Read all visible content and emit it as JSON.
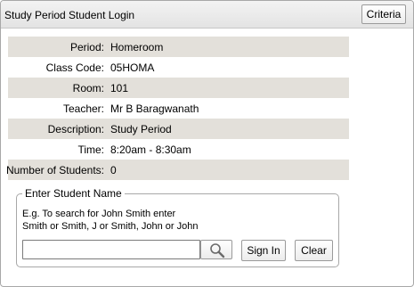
{
  "header": {
    "title": "Study Period Student Login",
    "criteria_label": "Criteria"
  },
  "details": [
    {
      "label": "Period:",
      "value": "Homeroom"
    },
    {
      "label": "Class Code:",
      "value": "05HOMA"
    },
    {
      "label": "Room:",
      "value": "101"
    },
    {
      "label": "Teacher:",
      "value": "Mr B Baragwanath"
    },
    {
      "label": "Description:",
      "value": "Study Period"
    },
    {
      "label": "Time:",
      "value": "8:20am - 8:30am"
    },
    {
      "label": "Number of Students:",
      "value": "0"
    }
  ],
  "search": {
    "legend": "Enter Student Name",
    "hint_line1": "E.g. To search for John Smith enter",
    "hint_line2": "Smith or Smith, J or Smith, John or John",
    "input_value": "",
    "search_icon": "magnifier-icon",
    "sign_in_label": "Sign In",
    "clear_label": "Clear"
  },
  "colors": {
    "row_shade": "#e3e0da",
    "header_bg": "#e8e8e8",
    "border": "#a8a8a8"
  }
}
